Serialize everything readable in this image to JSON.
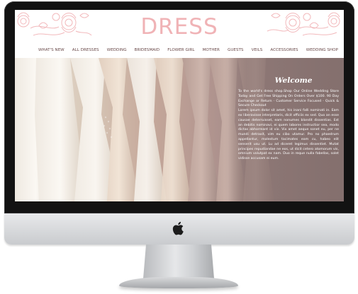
{
  "site": {
    "title": "DRESS",
    "brand_color": "#f0b3b6"
  },
  "nav": {
    "items": [
      {
        "label": "WHAT'S NEW"
      },
      {
        "label": "ALL DRESSES"
      },
      {
        "label": "WEDDING"
      },
      {
        "label": "BRIDESMAID"
      },
      {
        "label": "FLOWER GIRL"
      },
      {
        "label": "MOTHER"
      },
      {
        "label": "GUESTS"
      },
      {
        "label": "VEILS"
      },
      {
        "label": "ACCESSORIES"
      },
      {
        "label": "WEDDING SHOP"
      }
    ]
  },
  "hero": {
    "welcome_title": "Welcome",
    "intro_text": "To the world's dress shop.Shop Our Online Wedding Store Today and Get Free Shipping On Orders Over $100. 90 Day Exchange or Return · Customer Service Focused · Quick & Secure Checkout",
    "body_text": "Lorem ipsum dolor sit amet, his inani falli nominati in. Eam ex liberavisse interpretaris, dicit officiis ex sed. Quo an esse causae deterruisset, eam nonumes blandit dissentias. Est an debitis nominavi, ei quem labores instructior sea, modo dictas abhorreant id vix. Vix amet aeque sonet eu, per ne mundi detraxit, vim eu cibo utamur. Pro no phaedrum appellantur, molestum tacimates eam cu, habeo elit senserit usu ut. Lu ad diceret legimus dissentiet. Mutat principes repudiandae ne eos, ut dicit cetero atomorum vis, omnium volutpat ex nam. Duo in reque nulla fabellas, solet vidisse accusam ei eum."
  },
  "device": {
    "logo_icon": "apple-logo-icon"
  }
}
